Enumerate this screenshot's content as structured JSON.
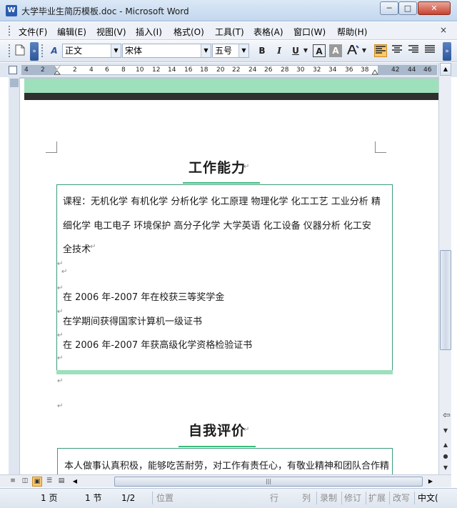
{
  "window": {
    "title": "大学毕业生简历模板.doc - Microsoft Word",
    "app_icon": "W",
    "min": "─",
    "max": "□",
    "close": "✕"
  },
  "menu": {
    "items": [
      "文件(F)",
      "编辑(E)",
      "视图(V)",
      "插入(I)",
      "格式(O)",
      "工具(T)",
      "表格(A)",
      "窗口(W)",
      "帮助(H)"
    ],
    "close": "×"
  },
  "toolbar": {
    "style": "正文",
    "font": "宋体",
    "size": "五号",
    "bold": "B",
    "italic": "I",
    "underline": "U",
    "char_border": "A",
    "char_shade": "A",
    "new_icon": "new-document-icon",
    "styles_icon": "styles-formatting-icon"
  },
  "ruler": {
    "ticks": [
      "4",
      "2",
      "2",
      "4",
      "6",
      "8",
      "10",
      "12",
      "14",
      "16",
      "18",
      "20",
      "22",
      "24",
      "26",
      "28",
      "30",
      "32",
      "34",
      "36",
      "38",
      "42",
      "44",
      "46"
    ]
  },
  "document": {
    "section1_title": "工作能力",
    "section1_lines": [
      "课程：无机化学  有机化学  分析化学  化工原理  物理化学  化工工艺  工业分析  精",
      "细化学  电工电子  环境保护  高分子化学  大学英语  化工设备  仪器分析  化工安",
      "全技术",
      "在 2006 年-2007 年在校获三等奖学金",
      "在学期间获得国家计算机一级证书",
      "在 2006 年-2007 年获高级化学资格检验证书"
    ],
    "section2_title": "自我评价",
    "section2_line": "本人做事认真积极，能够吃苦耐劳，对工作有责任心，有敬业精神和团队合作精",
    "para_mark": "↵"
  },
  "statusbar": {
    "page": "1 页",
    "section": "1 节",
    "pages": "1/2",
    "position": "位置",
    "line": "行",
    "column": "列",
    "rec": "录制",
    "trk": "修订",
    "ext": "扩展",
    "ovr": "改写",
    "language": "中文("
  },
  "colors": {
    "accent_green": "#9de0bb",
    "title_underline": "#3cba7d",
    "box_border": "#3c9c78"
  }
}
